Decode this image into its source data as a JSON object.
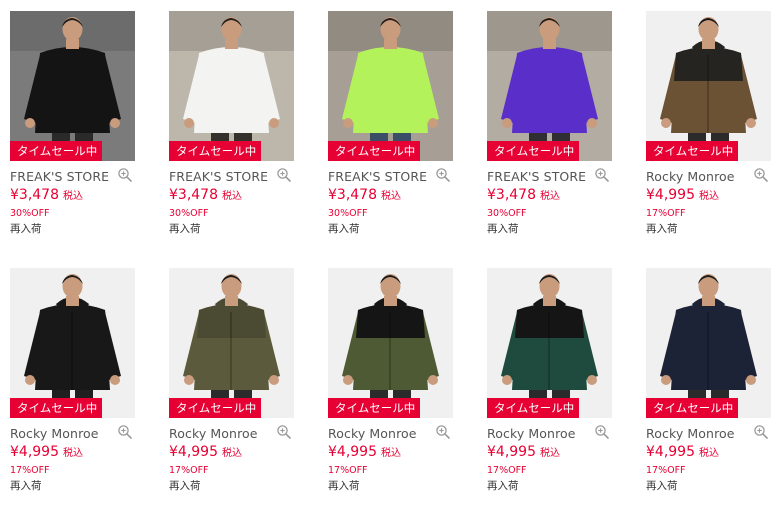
{
  "products": [
    {
      "brand": "FREAK'S STORE",
      "price": "¥3,478",
      "tax": "税込",
      "discount": "30%OFF",
      "status": "再入荷",
      "badge": "タイムセール中",
      "bg": "#7b7b7b",
      "garment": "#141414",
      "accent": "#141414",
      "pants": "#2a2a2a",
      "skin": "#c99c7e",
      "hair": "#1e1a16"
    },
    {
      "brand": "FREAK'S STORE",
      "price": "¥3,478",
      "tax": "税込",
      "discount": "30%OFF",
      "status": "再入荷",
      "badge": "タイムセール中",
      "bg": "#bdb6ab",
      "garment": "#f3f3f1",
      "accent": "#f3f3f1",
      "pants": "#34312d",
      "skin": "#c99c7e",
      "hair": "#221d18"
    },
    {
      "brand": "FREAK'S STORE",
      "price": "¥3,478",
      "tax": "税込",
      "discount": "30%OFF",
      "status": "再入荷",
      "badge": "タイムセール中",
      "bg": "#a79f95",
      "garment": "#b3f25a",
      "accent": "#b3f25a",
      "pants": "#3a4e66",
      "skin": "#c99c7e",
      "hair": "#221d18"
    },
    {
      "brand": "FREAK'S STORE",
      "price": "¥3,478",
      "tax": "税込",
      "discount": "30%OFF",
      "status": "再入荷",
      "badge": "タイムセール中",
      "bg": "#b3aca2",
      "garment": "#5a2ec9",
      "accent": "#5a2ec9",
      "pants": "#2f2f33",
      "skin": "#c99c7e",
      "hair": "#221d18"
    },
    {
      "brand": "Rocky Monroe",
      "price": "¥4,995",
      "tax": "税込",
      "discount": "17%OFF",
      "status": "再入荷",
      "badge": "タイムセール中",
      "bg": "#f0f0f0",
      "garment": "#6b5234",
      "accent": "#262420",
      "pants": "#2b2b2b",
      "skin": "#c99c7e",
      "hair": "#151515"
    },
    {
      "brand": "Rocky Monroe",
      "price": "¥4,995",
      "tax": "税込",
      "discount": "17%OFF",
      "status": "再入荷",
      "badge": "タイムセール中",
      "bg": "#f0f0f0",
      "garment": "#181818",
      "accent": "#181818",
      "pants": "#1f1f1f",
      "skin": "#c99c7e",
      "hair": "#1a1a1a"
    },
    {
      "brand": "Rocky Monroe",
      "price": "¥4,995",
      "tax": "税込",
      "discount": "17%OFF",
      "status": "再入荷",
      "badge": "タイムセール中",
      "bg": "#f0f0f0",
      "garment": "#5b5a3c",
      "accent": "#4b4a32",
      "pants": "#2b2b2b",
      "skin": "#c99c7e",
      "hair": "#1a1a1a"
    },
    {
      "brand": "Rocky Monroe",
      "price": "¥4,995",
      "tax": "税込",
      "discount": "17%OFF",
      "status": "再入荷",
      "badge": "タイムセール中",
      "bg": "#f0f0f0",
      "garment": "#4e5a33",
      "accent": "#151515",
      "pants": "#2b2b2b",
      "skin": "#c99c7e",
      "hair": "#1a1a1a"
    },
    {
      "brand": "Rocky Monroe",
      "price": "¥4,995",
      "tax": "税込",
      "discount": "17%OFF",
      "status": "再入荷",
      "badge": "タイムセール中",
      "bg": "#f0f0f0",
      "garment": "#1f4a3e",
      "accent": "#151515",
      "pants": "#2b2b2b",
      "skin": "#c99c7e",
      "hair": "#1a1a1a"
    },
    {
      "brand": "Rocky Monroe",
      "price": "¥4,995",
      "tax": "税込",
      "discount": "17%OFF",
      "status": "再入荷",
      "badge": "タイムセール中",
      "bg": "#f0f0f0",
      "garment": "#1d2336",
      "accent": "#1d2336",
      "pants": "#2b2b2b",
      "skin": "#c99c7e",
      "hair": "#1a1a1a"
    }
  ]
}
